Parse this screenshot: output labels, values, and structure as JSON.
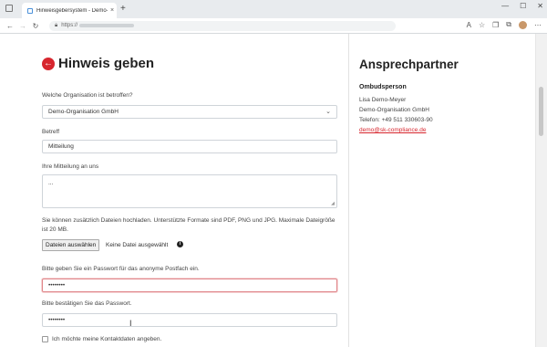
{
  "browser": {
    "tab_title": "Hinweisgebersystem - Demo-O",
    "tab_close": "×",
    "new_tab": "+",
    "url_prefix": "https://",
    "window_controls": [
      "—",
      "☐",
      "✕"
    ]
  },
  "form": {
    "title": "Hinweis geben",
    "org_label": "Welche Organisation ist betroffen?",
    "org_value": "Demo-Organisation GmbH",
    "subject_label": "Betreff",
    "subject_value": "Mitteilung",
    "message_label": "Ihre Mitteilung an uns",
    "message_value": "...",
    "upload_help": "Sie können zusätzlich Dateien hochladen. Unterstützte Formate sind PDF, PNG und JPG. Maximale Dateigröße ist 20 MB.",
    "file_button": "Dateien auswählen",
    "file_status": "Keine Datei ausgewählt",
    "password_label": "Bitte geben Sie ein Passwort für das anonyme Postfach ein.",
    "password_value": "••••••••",
    "password_confirm_label": "Bitte bestätigen Sie das Passwort.",
    "password_confirm_value": "••••••••",
    "contact_checkbox_label": "Ich möchte meine Kontaktdaten angeben."
  },
  "contact": {
    "title": "Ansprechpartner",
    "role": "Ombudsperson",
    "name": "Lisa Demo-Meyer",
    "org": "Demo-Organisation GmbH",
    "phone": "Telefon: +49 511 330603-90",
    "email": "demo@sk-compliance.de"
  },
  "icons": {
    "back": "arrow-left-icon",
    "info": "info-icon",
    "chevron": "chevron-down-icon"
  }
}
